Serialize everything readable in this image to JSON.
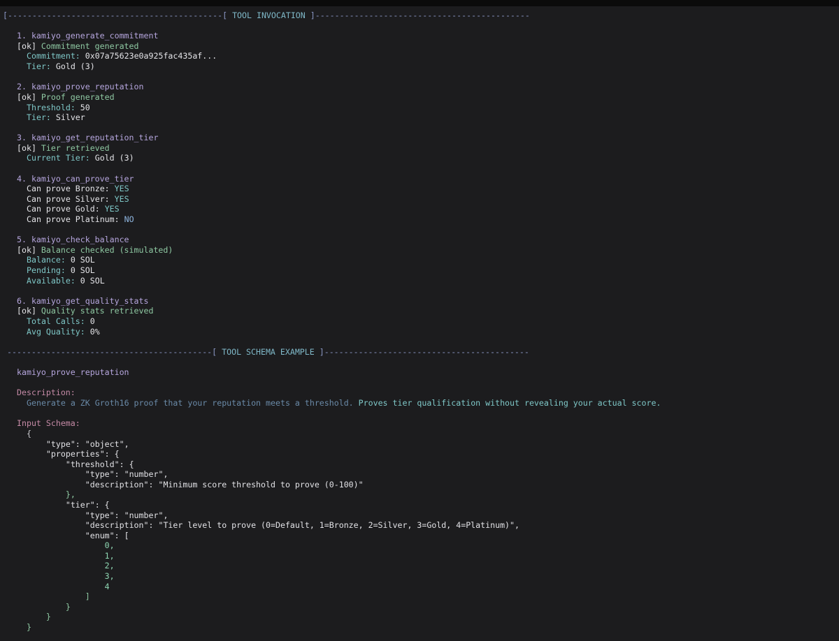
{
  "header": {
    "invocation_rule_left": "[--------------------------------------------[ ",
    "invocation_title": "TOOL INVOCATION",
    "invocation_rule_right": " ]--------------------------------------------",
    "schema_rule_left": "------------------------------------------[ ",
    "schema_title": "TOOL SCHEMA EXAMPLE",
    "schema_rule_right": " ]------------------------------------------"
  },
  "tools": [
    {
      "heading": "1. kamiyo_generate_commitment",
      "status_tag": "[ok]",
      "status_text": " Commitment generated",
      "fields": [
        {
          "label": "Commitment: ",
          "value": "0x07a75623e0a925fac435af..."
        },
        {
          "label": "Tier: ",
          "value": "Gold (3)"
        }
      ]
    },
    {
      "heading": "2. kamiyo_prove_reputation",
      "status_tag": "[ok]",
      "status_text": " Proof generated",
      "fields": [
        {
          "label": "Threshold: ",
          "value": "50"
        },
        {
          "label": "Tier: ",
          "value": "Silver"
        }
      ]
    },
    {
      "heading": "3. kamiyo_get_reputation_tier",
      "status_tag": "[ok]",
      "status_text": " Tier retrieved",
      "fields": [
        {
          "label": "Current Tier: ",
          "value": "Gold (3)"
        }
      ]
    },
    {
      "heading": "4. kamiyo_can_prove_tier",
      "fields": [
        {
          "label": "Can prove Bronze: ",
          "value": "YES"
        },
        {
          "label": "Can prove Silver: ",
          "value": "YES"
        },
        {
          "label": "Can prove Gold: ",
          "value": "YES"
        },
        {
          "label": "Can prove Platinum: ",
          "value": "NO"
        }
      ]
    },
    {
      "heading": "5. kamiyo_check_balance",
      "status_tag": "[ok]",
      "status_text": " Balance checked (simulated)",
      "fields": [
        {
          "label": "Balance: ",
          "value": "0 SOL"
        },
        {
          "label": "Pending: ",
          "value": "0 SOL"
        },
        {
          "label": "Available: ",
          "value": "0 SOL"
        }
      ]
    },
    {
      "heading": "6. kamiyo_get_quality_stats",
      "status_tag": "[ok]",
      "status_text": " Quality stats retrieved",
      "fields": [
        {
          "label": "Total Calls: ",
          "value": "0"
        },
        {
          "label": "Avg Quality: ",
          "value": "0%"
        }
      ]
    }
  ],
  "schema": {
    "tool_name": "kamiyo_prove_reputation",
    "description_label": "Description:",
    "description_dim": "Generate a ZK Groth16 proof that your reputation meets a threshold.",
    "description_bright": " Proves tier qualification without revealing your actual score.",
    "input_label": "Input Schema:",
    "json_lines": [
      "{",
      "    \"type\": \"object\",",
      "    \"properties\": {",
      "        \"threshold\": {",
      "            \"type\": \"number\",",
      "            \"description\": \"Minimum score threshold to prove (0-100)\"",
      "        },",
      "        \"tier\": {",
      "            \"type\": \"number\",",
      "            \"description\": \"Tier level to prove (0=Default, 1=Bronze, 2=Silver, 3=Gold, 4=Platinum)\",",
      "            \"enum\": [",
      "                0,",
      "                1,",
      "                2,",
      "                3,",
      "                4",
      "            ]",
      "        }",
      "    }",
      "}"
    ]
  }
}
